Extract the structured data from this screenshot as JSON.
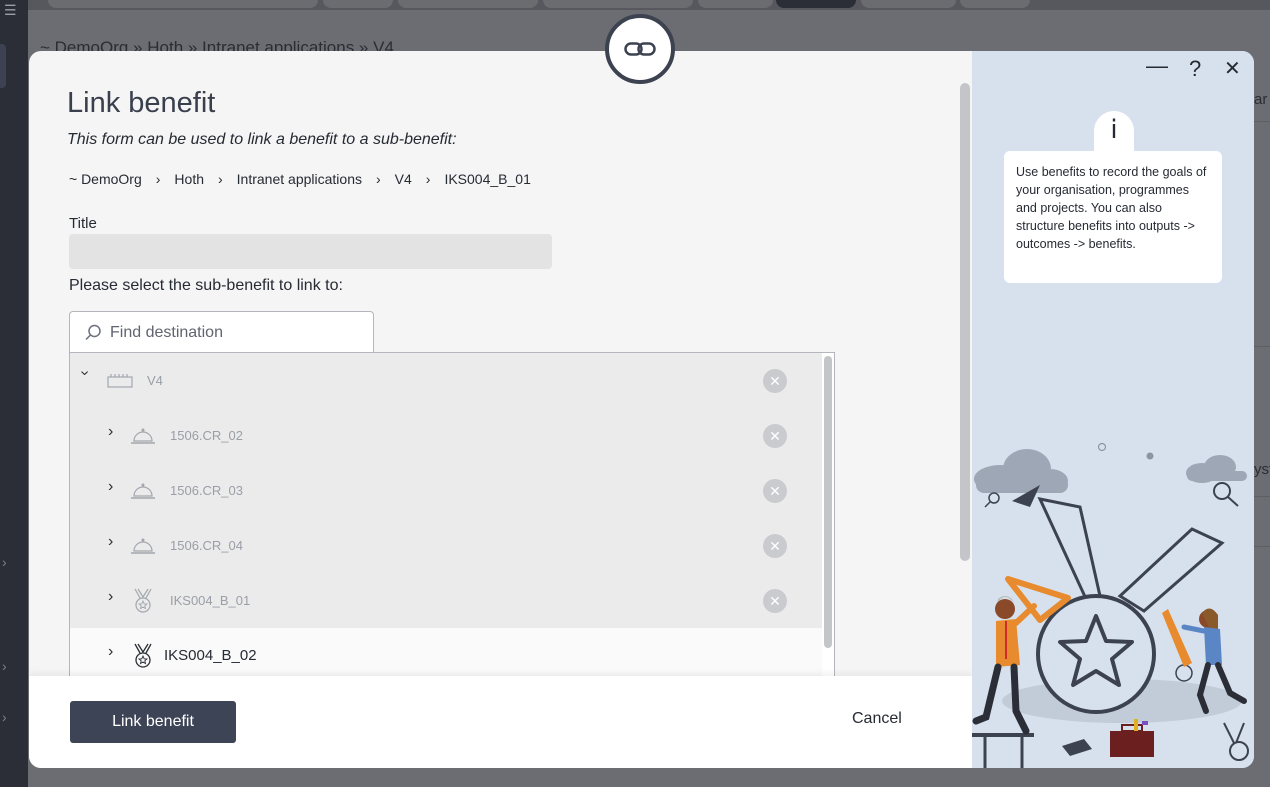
{
  "modal": {
    "title": "Link benefit",
    "subtitle": "This form can be used to link a benefit to a sub-benefit:",
    "breadcrumb": [
      "~ DemoOrg",
      "Hoth",
      "Intranet applications",
      "V4",
      "IKS004_B_01"
    ],
    "title_field_label": "Title",
    "title_field_value": "",
    "select_label": "Please select the sub-benefit to link to:",
    "search_placeholder": "Find destination",
    "tree": [
      {
        "label": "V4",
        "icon": "programme-icon",
        "expanded": true,
        "level": 0,
        "disabled": true
      },
      {
        "label": "1506.CR_02",
        "icon": "bell-icon",
        "level": 1,
        "disabled": true
      },
      {
        "label": "1506.CR_03",
        "icon": "bell-icon",
        "level": 1,
        "disabled": true
      },
      {
        "label": "1506.CR_04",
        "icon": "bell-icon",
        "level": 1,
        "disabled": true
      },
      {
        "label": "IKS004_B_01",
        "icon": "medal-icon",
        "level": 1,
        "disabled": true
      },
      {
        "label": "IKS004_B_02",
        "icon": "medal-icon",
        "level": 1,
        "disabled": false
      }
    ],
    "primary_button": "Link benefit",
    "cancel_button": "Cancel"
  },
  "info_panel": {
    "info_glyph": "i",
    "text": "Use benefits to record the goals of your organisation, programmes and projects. You can also structure benefits into outputs -> outcomes -> benefits.",
    "minimize": "—",
    "help": "?",
    "close": "✕"
  },
  "background": {
    "breadcrumb": "~ DemoOrg  »  Hoth  »  Intranet applications  »  V4",
    "right_fragments": [
      "ar",
      "yst"
    ]
  },
  "colors": {
    "primary": "#3d4456",
    "panel_bg": "#d7e1ee",
    "row_disabled_bg": "#ebebeb"
  }
}
